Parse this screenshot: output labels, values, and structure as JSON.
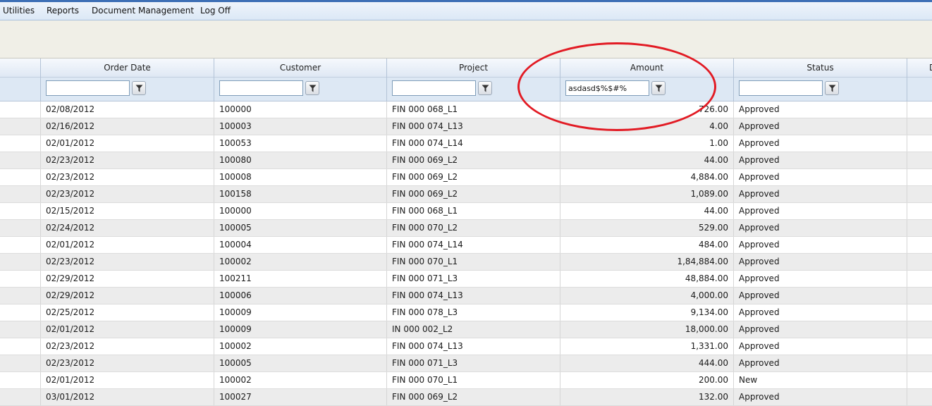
{
  "menu": {
    "items": [
      "Utilities",
      "Reports",
      "Document Management",
      "Log Off"
    ]
  },
  "grid": {
    "columns": [
      "Order Date",
      "Customer",
      "Project",
      "Amount",
      "Status",
      "D"
    ],
    "filters": {
      "order_date": "",
      "customer": "",
      "project": "",
      "amount": "asdasd$%$#%",
      "status": ""
    },
    "rows": [
      [
        "02/08/2012",
        "100000",
        "FIN 000 068_L1",
        "726.00",
        "Approved"
      ],
      [
        "02/16/2012",
        "100003",
        "FIN 000 074_L13",
        "4.00",
        "Approved"
      ],
      [
        "02/01/2012",
        "100053",
        "FIN 000 074_L14",
        "1.00",
        "Approved"
      ],
      [
        "02/23/2012",
        "100080",
        "FIN 000 069_L2",
        "44.00",
        "Approved"
      ],
      [
        "02/23/2012",
        "100008",
        "FIN 000 069_L2",
        "4,884.00",
        "Approved"
      ],
      [
        "02/23/2012",
        "100158",
        "FIN 000 069_L2",
        "1,089.00",
        "Approved"
      ],
      [
        "02/15/2012",
        "100000",
        "FIN 000 068_L1",
        "44.00",
        "Approved"
      ],
      [
        "02/24/2012",
        "100005",
        "FIN 000 070_L2",
        "529.00",
        "Approved"
      ],
      [
        "02/01/2012",
        "100004",
        "FIN 000 074_L14",
        "484.00",
        "Approved"
      ],
      [
        "02/23/2012",
        "100002",
        "FIN 000 070_L1",
        "1,84,884.00",
        "Approved"
      ],
      [
        "02/29/2012",
        "100211",
        "FIN 000 071_L3",
        "48,884.00",
        "Approved"
      ],
      [
        "02/29/2012",
        "100006",
        "FIN 000 074_L13",
        "4,000.00",
        "Approved"
      ],
      [
        "02/25/2012",
        "100009",
        "FIN 000 078_L3",
        "9,134.00",
        "Approved"
      ],
      [
        "02/01/2012",
        "100009",
        "IN 000 002_L2",
        "18,000.00",
        "Approved"
      ],
      [
        "02/23/2012",
        "100002",
        "FIN 000 074_L13",
        "1,331.00",
        "Approved"
      ],
      [
        "02/23/2012",
        "100005",
        "FIN 000 071_L3",
        "444.00",
        "Approved"
      ],
      [
        "02/01/2012",
        "100002",
        "FIN 000 070_L1",
        "200.00",
        "New"
      ],
      [
        "03/01/2012",
        "100027",
        "FIN 000 069_L2",
        "132.00",
        "Approved"
      ]
    ]
  },
  "icons": {
    "filter": "funnel-icon"
  },
  "colors": {
    "annotation": "#e21b24",
    "header": "#dfe8f4",
    "alt_row": "#ececec"
  }
}
